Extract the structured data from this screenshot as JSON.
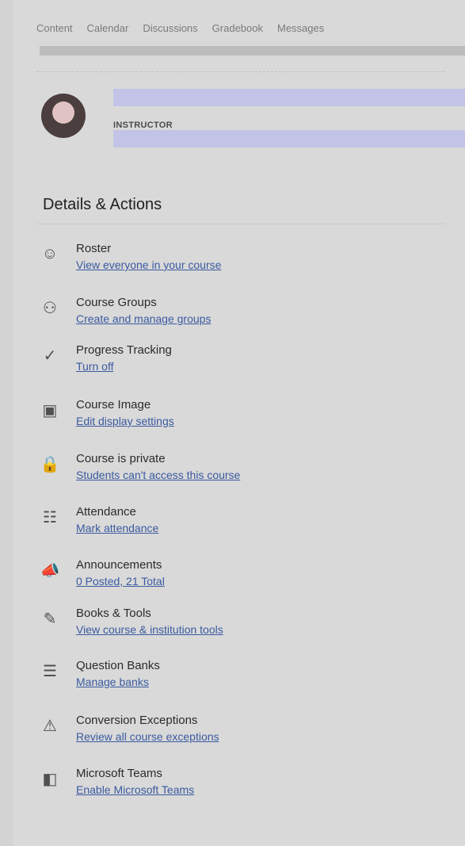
{
  "nav": {
    "tabs": [
      "Content",
      "Calendar",
      "Discussions",
      "Gradebook",
      "Messages"
    ]
  },
  "profile": {
    "role": "INSTRUCTOR"
  },
  "details": {
    "title": "Details & Actions",
    "items": [
      {
        "icon": "roster-icon",
        "title": "Roster",
        "link": "View everyone in your course"
      },
      {
        "icon": "groups-icon",
        "title": "Course Groups",
        "link": "Create and manage groups"
      },
      {
        "icon": "progress-icon",
        "title": "Progress Tracking",
        "link": "Turn off"
      },
      {
        "icon": "image-icon",
        "title": "Course Image",
        "link": "Edit display settings"
      },
      {
        "icon": "lock-icon",
        "title": "Course is private",
        "link": "Students can't access this course"
      },
      {
        "icon": "attendance-icon",
        "title": "Attendance",
        "link": "Mark attendance"
      },
      {
        "icon": "announcement-icon",
        "title": "Announcements",
        "link": "0 Posted, 21 Total"
      },
      {
        "icon": "tools-icon",
        "title": "Books & Tools",
        "link": "View course & institution tools"
      },
      {
        "icon": "question-bank-icon",
        "title": "Question Banks",
        "link": "Manage banks"
      },
      {
        "icon": "exception-icon",
        "title": "Conversion Exceptions",
        "link": "Review all course exceptions"
      },
      {
        "icon": "teams-icon",
        "title": "Microsoft Teams",
        "link": "Enable Microsoft Teams"
      }
    ]
  },
  "colors": {
    "link": "#3a5aa0",
    "heading": "#1f1f1f"
  }
}
